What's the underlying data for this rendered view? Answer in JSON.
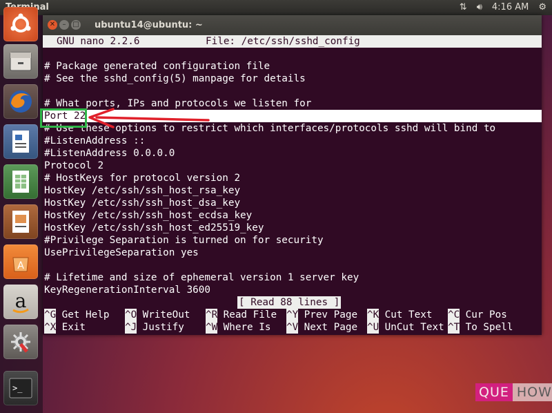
{
  "panel": {
    "app_name": "Terminal",
    "time": "4:16 AM",
    "icons": [
      "network-updown-icon",
      "volume-icon",
      "power-gear-icon"
    ]
  },
  "launcher": {
    "items": [
      "ubuntu-dash-icon",
      "files-icon",
      "firefox-icon",
      "libreoffice-writer-icon",
      "libreoffice-calc-icon",
      "libreoffice-impress-icon",
      "software-center-icon",
      "amazon-icon",
      "system-settings-icon",
      "terminal-icon"
    ]
  },
  "window": {
    "title": "ubuntu14@ubuntu: ~"
  },
  "nano": {
    "version": "GNU nano 2.2.6",
    "file": "File: /etc/ssh/sshd_config",
    "lines": [
      "",
      "# Package generated configuration file",
      "# See the sshd_config(5) manpage for details",
      "",
      "# What ports, IPs and protocols we listen for",
      "Port 22",
      "# Use these options to restrict which interfaces/protocols sshd will bind to",
      "#ListenAddress ::",
      "#ListenAddress 0.0.0.0",
      "Protocol 2",
      "# HostKeys for protocol version 2",
      "HostKey /etc/ssh/ssh_host_rsa_key",
      "HostKey /etc/ssh/ssh_host_dsa_key",
      "HostKey /etc/ssh/ssh_host_ecdsa_key",
      "HostKey /etc/ssh/ssh_host_ed25519_key",
      "#Privilege Separation is turned on for security",
      "UsePrivilegeSeparation yes",
      "",
      "# Lifetime and size of ephemeral version 1 server key",
      "KeyRegenerationInterval 3600"
    ],
    "status": "[ Read 88 lines ]",
    "shortcuts_row1": [
      {
        "key": "^G",
        "label": " Get Help"
      },
      {
        "key": "^O",
        "label": " WriteOut"
      },
      {
        "key": "^R",
        "label": " Read File"
      },
      {
        "key": "^Y",
        "label": " Prev Page"
      },
      {
        "key": "^K",
        "label": " Cut Text"
      },
      {
        "key": "^C",
        "label": " Cur Pos"
      }
    ],
    "shortcuts_row2": [
      {
        "key": "^X",
        "label": " Exit"
      },
      {
        "key": "^J",
        "label": " Justify"
      },
      {
        "key": "^W",
        "label": " Where Is"
      },
      {
        "key": "^V",
        "label": " Next Page"
      },
      {
        "key": "^U",
        "label": " UnCut Text"
      },
      {
        "key": "^T",
        "label": " To Spell"
      }
    ]
  },
  "watermark": {
    "part1": "QUE",
    "part2": "HOW"
  },
  "colors": {
    "terminal_bg": "#300a24",
    "highlight_box": "#2fb548",
    "arrow": "#e0212b"
  }
}
